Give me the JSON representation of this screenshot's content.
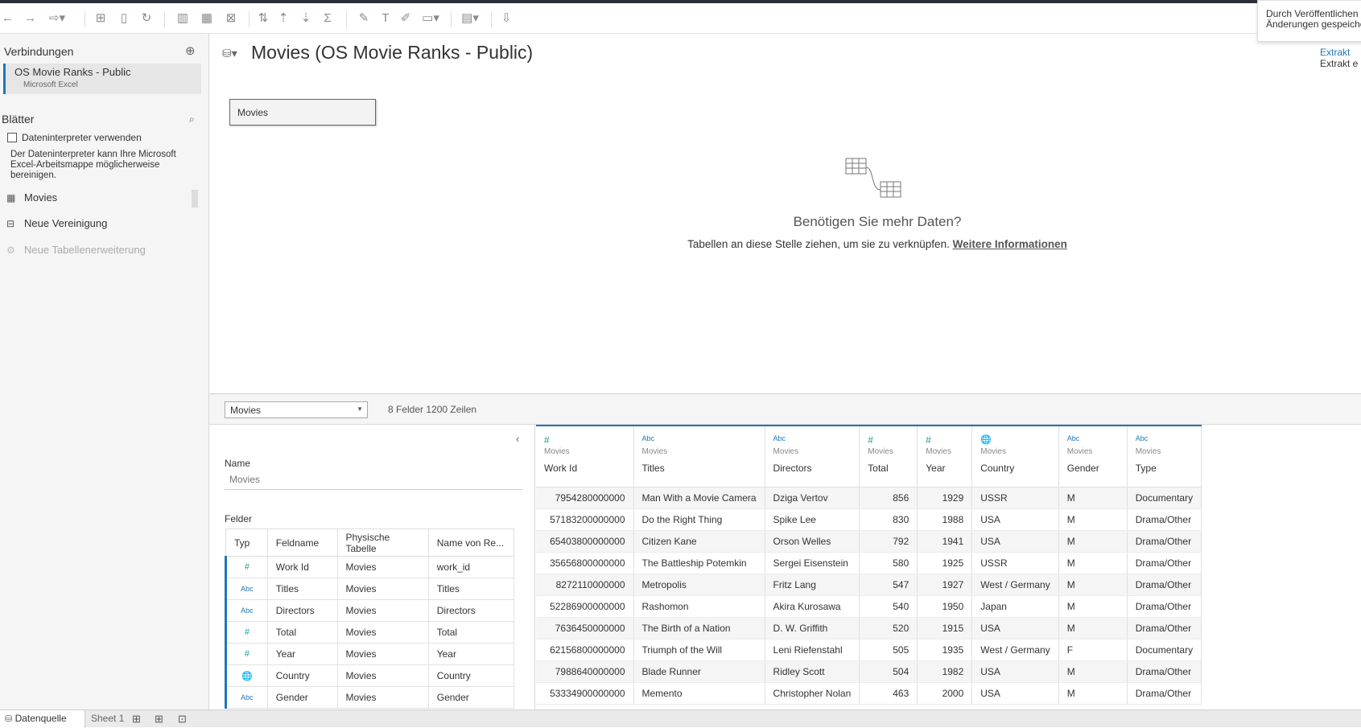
{
  "toolbar": {
    "icons": [
      "back-icon",
      "forward-icon",
      "redo-icon",
      "new-datasource-icon",
      "pause-icon",
      "refresh-icon",
      "swap-icon",
      "sort-asc-icon",
      "sort-desc-icon",
      "sum-icon",
      "highlight-icon",
      "label-icon",
      "format-icon",
      "fit-icon",
      "show-me-icon",
      "presentation-icon"
    ]
  },
  "tooltip": {
    "line1": "Durch Veröffentlichen v",
    "line2": "Änderungen gespeiche"
  },
  "left": {
    "connections_title": "Verbindungen",
    "connection_name": "OS Movie Ranks - Public",
    "connection_type": "Microsoft Excel",
    "sheets_title": "Blätter",
    "interpreter_label": "Dateninterpreter verwenden",
    "interpreter_desc": "Der Dateninterpreter kann Ihre Microsoft Excel-Arbeitsmappe möglicherweise bereinigen.",
    "sheets": [
      "Movies",
      "Neue Vereinigung",
      "Neue Tabellenerweiterung"
    ]
  },
  "canvas": {
    "title": "Movies (OS Movie Ranks - Public)",
    "table_box": "Movies",
    "extract_label": "Extrakt",
    "extract_sub": "Extrakt e",
    "need_title": "Benötigen Sie mehr Daten?",
    "need_sub": "Tabellen an diese Stelle ziehen, um sie zu verknüpfen.",
    "need_link": "Weitere Informationen"
  },
  "midbar": {
    "selected_table": "Movies",
    "counts": "8 Felder 1200 Zeilen"
  },
  "meta": {
    "name_label": "Name",
    "name_value": "Movies",
    "fields_label": "Felder",
    "headers": [
      "Typ",
      "Feldname",
      "Physische Tabelle",
      "Name von Re..."
    ],
    "rows": [
      {
        "type": "#",
        "field": "Work Id",
        "table": "Movies",
        "remote": "work_id"
      },
      {
        "type": "Abc",
        "field": "Titles",
        "table": "Movies",
        "remote": "Titles"
      },
      {
        "type": "Abc",
        "field": "Directors",
        "table": "Movies",
        "remote": "Directors"
      },
      {
        "type": "#",
        "field": "Total",
        "table": "Movies",
        "remote": "Total"
      },
      {
        "type": "#",
        "field": "Year",
        "table": "Movies",
        "remote": "Year"
      },
      {
        "type": "🌐",
        "field": "Country",
        "table": "Movies",
        "remote": "Country"
      },
      {
        "type": "Abc",
        "field": "Gender",
        "table": "Movies",
        "remote": "Gender"
      }
    ]
  },
  "grid": {
    "source": "Movies",
    "columns": [
      {
        "type": "#",
        "name": "Work Id"
      },
      {
        "type": "Abc",
        "name": "Titles"
      },
      {
        "type": "Abc",
        "name": "Directors"
      },
      {
        "type": "#",
        "name": "Total"
      },
      {
        "type": "#",
        "name": "Year"
      },
      {
        "type": "🌐",
        "name": "Country"
      },
      {
        "type": "Abc",
        "name": "Gender"
      },
      {
        "type": "Abc",
        "name": "Type"
      }
    ],
    "rows": [
      [
        "7954280000000",
        "Man With a Movie Camera",
        "Dziga Vertov",
        "856",
        "1929",
        "USSR",
        "M",
        "Documentary"
      ],
      [
        "57183200000000",
        "Do the Right Thing",
        "Spike Lee",
        "830",
        "1988",
        "USA",
        "M",
        "Drama/Other"
      ],
      [
        "65403800000000",
        "Citizen Kane",
        "Orson Welles",
        "792",
        "1941",
        "USA",
        "M",
        "Drama/Other"
      ],
      [
        "35656800000000",
        "The Battleship Potemkin",
        "Sergei Eisenstein",
        "580",
        "1925",
        "USSR",
        "M",
        "Drama/Other"
      ],
      [
        "8272110000000",
        "Metropolis",
        "Fritz Lang",
        "547",
        "1927",
        "West / Germany",
        "M",
        "Drama/Other"
      ],
      [
        "52286900000000",
        "Rashomon",
        "Akira Kurosawa",
        "540",
        "1950",
        "Japan",
        "M",
        "Drama/Other"
      ],
      [
        "7636450000000",
        "The Birth of a Nation",
        "D. W. Griffith",
        "520",
        "1915",
        "USA",
        "M",
        "Drama/Other"
      ],
      [
        "62156800000000",
        "Triumph of the Will",
        "Leni Riefenstahl",
        "505",
        "1935",
        "West / Germany",
        "F",
        "Documentary"
      ],
      [
        "7988640000000",
        "Blade Runner",
        "Ridley Scott",
        "504",
        "1982",
        "USA",
        "M",
        "Drama/Other"
      ],
      [
        "53334900000000",
        "Memento",
        "Christopher Nolan",
        "463",
        "2000",
        "USA",
        "M",
        "Drama/Other"
      ]
    ]
  },
  "bottom": {
    "datasource_tab": "Datenquelle",
    "sheet_tab": "Sheet 1"
  }
}
